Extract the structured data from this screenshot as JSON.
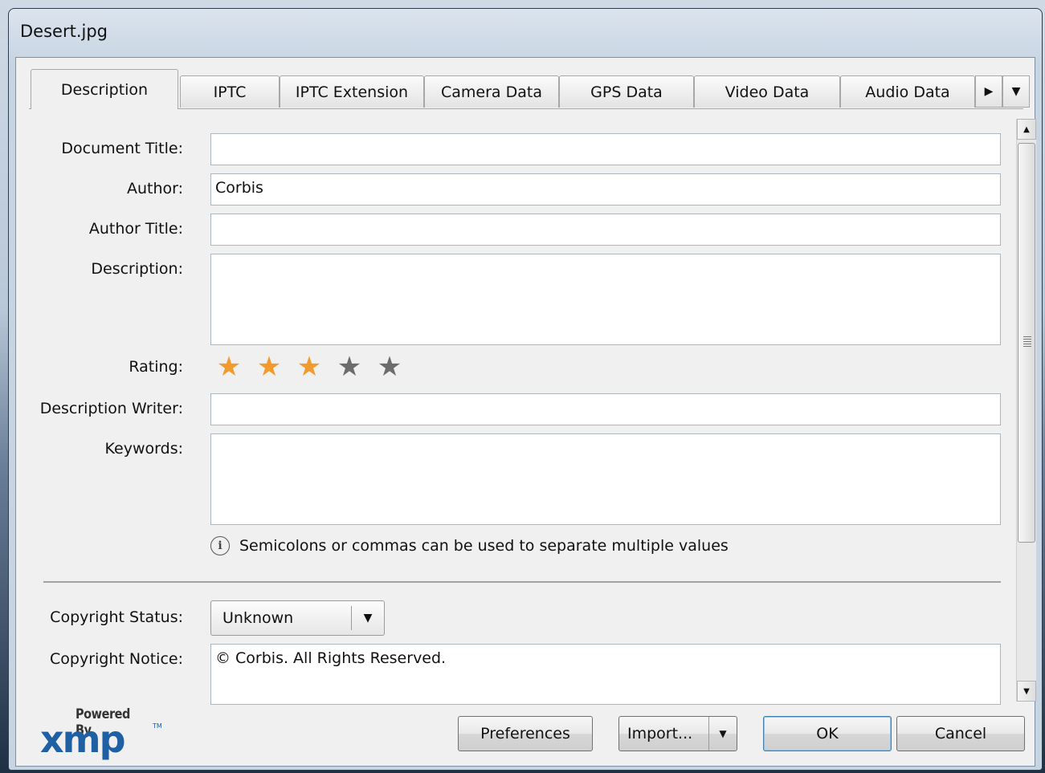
{
  "window": {
    "title": "Desert.jpg"
  },
  "tabs": [
    {
      "label": "Description",
      "active": true
    },
    {
      "label": "IPTC"
    },
    {
      "label": "IPTC Extension"
    },
    {
      "label": "Camera Data"
    },
    {
      "label": "GPS Data"
    },
    {
      "label": "Video Data"
    },
    {
      "label": "Audio Data"
    }
  ],
  "tab_controls": {
    "next": "▶",
    "menu": "▼"
  },
  "form": {
    "document_title": {
      "label": "Document Title:",
      "value": ""
    },
    "author": {
      "label": "Author:",
      "value": "Corbis"
    },
    "author_title": {
      "label": "Author Title:",
      "value": ""
    },
    "description": {
      "label": "Description:",
      "value": ""
    },
    "rating": {
      "label": "Rating:",
      "value": 3,
      "max": 5,
      "on_color": "#f29b2c",
      "off_color": "#6c6c6c"
    },
    "description_writer": {
      "label": "Description Writer:",
      "value": ""
    },
    "keywords": {
      "label": "Keywords:",
      "value": ""
    },
    "hint": "Semicolons or commas can be used to separate multiple values",
    "copyright_status": {
      "label": "Copyright Status:",
      "value": "Unknown"
    },
    "copyright_notice": {
      "label": "Copyright Notice:",
      "value": "© Corbis.  All Rights Reserved."
    }
  },
  "footer": {
    "powered_by": "Powered By",
    "logo": "xmp",
    "preferences": "Preferences",
    "import": "Import...",
    "ok": "OK",
    "cancel": "Cancel"
  },
  "icons": {
    "info": "info-icon",
    "star": "star-icon"
  }
}
